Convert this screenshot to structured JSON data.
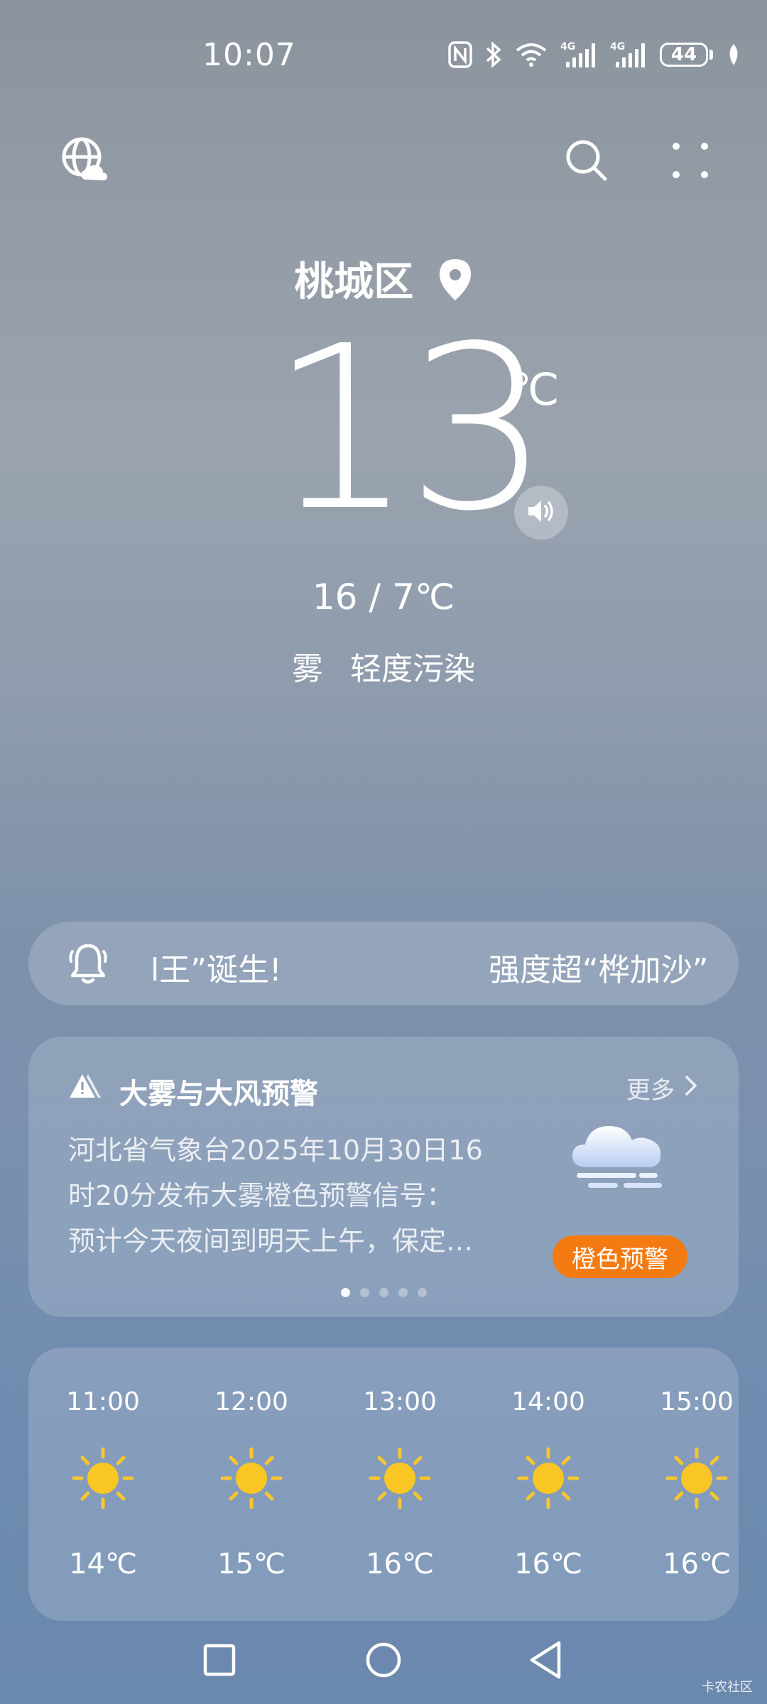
{
  "status_bar": {
    "time": "10:07",
    "network1": "4G",
    "network2": "4G",
    "battery": "44"
  },
  "top_bar": {
    "icons": [
      "globe-cloud-icon",
      "search-icon",
      "more-dots-icon"
    ]
  },
  "current": {
    "location": "桃城区",
    "temperature": "13",
    "unit": "℃",
    "high_low": "16 / 7℃",
    "condition": "雾",
    "air_quality": "轻度污染"
  },
  "notice": {
    "text_left": "l王”诞生!",
    "text_right": "强度超“桦加沙”"
  },
  "warning": {
    "title": "大雾与大风预警",
    "more": "更多",
    "lines": [
      "河北省气象台2025年10月30日16",
      "时20分发布大雾橙色预警信号：",
      "预计今天夜间到明天上午，保定…"
    ],
    "badge": "橙色预警",
    "badge_color": "#f47a12",
    "page_count": 5,
    "active_page": 1
  },
  "hourly": [
    {
      "time": "11:00",
      "icon": "sunny-icon",
      "temp": "14℃"
    },
    {
      "time": "12:00",
      "icon": "sunny-icon",
      "temp": "15℃"
    },
    {
      "time": "13:00",
      "icon": "sunny-icon",
      "temp": "16℃"
    },
    {
      "time": "14:00",
      "icon": "sunny-icon",
      "temp": "16℃"
    },
    {
      "time": "15:00",
      "icon": "sunny-icon",
      "temp": "16℃"
    }
  ],
  "nav_bar": {
    "icons": [
      "recents-square-icon",
      "home-circle-icon",
      "back-triangle-icon"
    ]
  },
  "watermark": "卡农社区"
}
